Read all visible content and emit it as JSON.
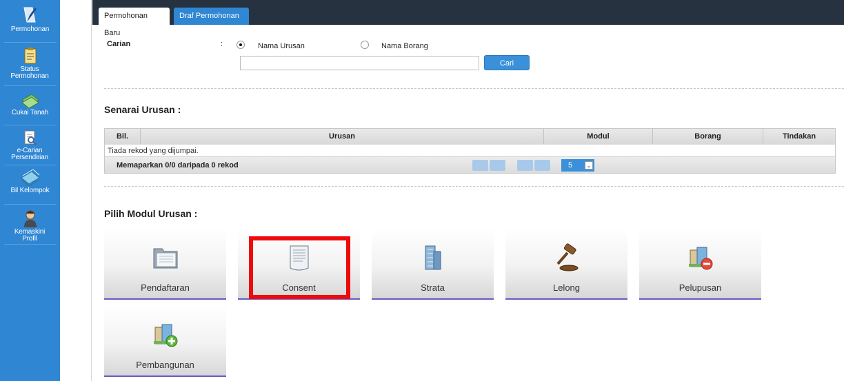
{
  "sidebar": {
    "items": [
      {
        "label": "Permohonan",
        "icon": "pen-icon"
      },
      {
        "label": "Status Permohonan",
        "icon": "clipboard-icon"
      },
      {
        "label": "Cukai Tanah",
        "icon": "money-icon"
      },
      {
        "label": "e-Carian Persendirian",
        "icon": "document-search-icon"
      },
      {
        "label": "Bil Kelompok",
        "icon": "money-stack-icon"
      },
      {
        "label": "Kemaskini Profil",
        "icon": "user-icon"
      }
    ]
  },
  "tabs": [
    {
      "label": "Permohonan Baru",
      "active": true
    },
    {
      "label": "Draf Permohonan",
      "active": false
    }
  ],
  "search": {
    "label": "Carian",
    "colon": ":",
    "options": [
      {
        "label": "Nama Urusan",
        "checked": true
      },
      {
        "label": "Nama Borang",
        "checked": false
      }
    ],
    "value": "",
    "button": "Cari"
  },
  "list": {
    "title": "Senarai Urusan :",
    "columns": [
      "Bil.",
      "Urusan",
      "Modul",
      "Borang",
      "Tindakan"
    ],
    "empty_message": "Tiada rekod yang dijumpai.",
    "footer_info": "Memaparkan 0/0 daripada 0 rekod",
    "page_size": "5"
  },
  "modules": {
    "title": "Pilih Modul Urusan :",
    "items": [
      {
        "label": "Pendaftaran",
        "icon": "folder-icon"
      },
      {
        "label": "Consent",
        "icon": "document-icon"
      },
      {
        "label": "Strata",
        "icon": "building-icon"
      },
      {
        "label": "Lelong",
        "icon": "gavel-icon"
      },
      {
        "label": "Pelupusan",
        "icon": "building-remove-icon"
      },
      {
        "label": "Pembangunan",
        "icon": "building-add-icon"
      }
    ]
  },
  "colors": {
    "sidebar": "#2f86d3",
    "topbar": "#26323f",
    "accent": "#3a90d9",
    "tile_underline": "#6b58c4",
    "highlight": "#ee0a0a"
  }
}
